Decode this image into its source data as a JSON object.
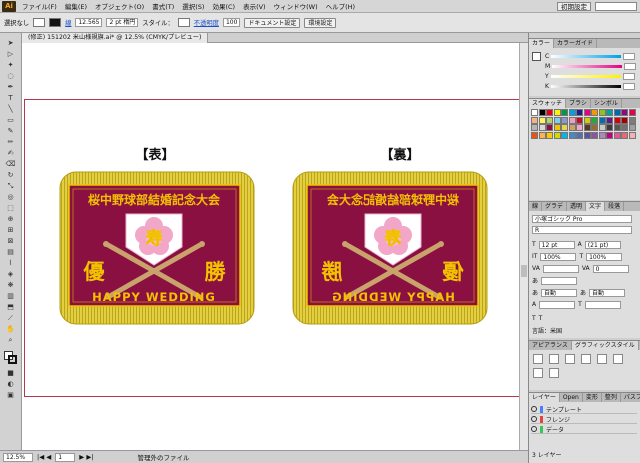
{
  "app": {
    "logo": "Ai"
  },
  "menubar": {
    "items": [
      "ファイル(F)",
      "編集(E)",
      "オブジェクト(O)",
      "書式(T)",
      "選択(S)",
      "効果(C)",
      "表示(V)",
      "ウィンドウ(W)",
      "ヘルプ(H)"
    ],
    "workspace": "初期設定"
  },
  "control": {
    "selection": "選択なし",
    "stroke_label": "線",
    "stroke_value": "12.565",
    "brush": "2 pt 楕円",
    "style_label": "スタイル：",
    "opacity_label": "不透明度",
    "opacity_value": "100",
    "doc_setup": "ドキュメント設定",
    "prefs": "環境設定"
  },
  "document": {
    "tab": "(修正) 151202 米山様規旗.ai* @ 12.5% (CMYK/プレビュー)"
  },
  "artwork": {
    "front_label": "【表】",
    "back_label": "【裏】",
    "banner_text": "桜中野球部結婚記念大会",
    "left_char": "優",
    "right_char": "勝",
    "center_char": "寿",
    "bottom_text": "HAPPY WEDDING",
    "colors": {
      "maroon": "#8b1042",
      "gold": "#f2c200",
      "frame": "#e6d44b",
      "bat": "#c9a36b",
      "blossom": "#f2a6c8"
    }
  },
  "status": {
    "zoom": "12.5%",
    "page": "1",
    "message": "管理外のファイル"
  },
  "panels": {
    "color_tabs": [
      "カラー",
      "カラーガイド"
    ],
    "channels": [
      "C",
      "M",
      "Y",
      "K"
    ],
    "swatch_tabs": [
      "スウォッチ",
      "ブラシ",
      "シンボル"
    ],
    "char_tabs": [
      "線",
      "グラデ",
      "透明",
      "文字",
      "段落"
    ],
    "font": "小塚ゴシック Pro",
    "font_style": "R",
    "font_size": "12 pt",
    "leading": "(21 pt)",
    "scale_h": "100%",
    "scale_v": "100%",
    "tracking": "0",
    "auto": "自動",
    "lang": "言語：米国",
    "appearance_tabs": [
      "アピアランス",
      "グラフィックスタイル"
    ],
    "layer_tabs": [
      "レイヤー",
      "Open",
      "変形",
      "整列",
      "パスフ"
    ],
    "layers": [
      "テンプレート",
      "フレンジ",
      "データ"
    ],
    "layer_count": "3 レイヤー"
  }
}
